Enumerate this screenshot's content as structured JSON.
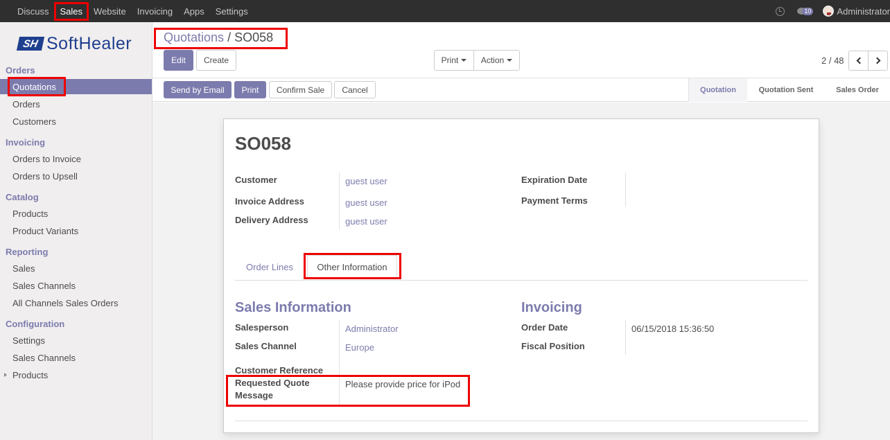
{
  "topbar": {
    "menu": [
      "Discuss",
      "Sales",
      "Website",
      "Invoicing",
      "Apps",
      "Settings"
    ],
    "messages_count": "10",
    "user_name": "Administrator"
  },
  "sidebar": {
    "logo_mark": "SH",
    "logo_text": "SoftHealer",
    "sections": {
      "orders": "Orders",
      "invoicing": "Invoicing",
      "catalog": "Catalog",
      "reporting": "Reporting",
      "configuration": "Configuration"
    },
    "items": {
      "quotations": "Quotations",
      "orders": "Orders",
      "customers": "Customers",
      "orders_to_invoice": "Orders to Invoice",
      "orders_to_upsell": "Orders to Upsell",
      "products": "Products",
      "product_variants": "Product Variants",
      "sales": "Sales",
      "sales_channels": "Sales Channels",
      "all_channels_sales_orders": "All Channels Sales Orders",
      "settings": "Settings",
      "config_sales_channels": "Sales Channels",
      "config_products": "Products"
    }
  },
  "control": {
    "breadcrumb_parent": "Quotations",
    "breadcrumb_separator": "/",
    "breadcrumb_current": "SO058",
    "edit": "Edit",
    "create": "Create",
    "print": "Print",
    "action": "Action",
    "pager": "2 / 48",
    "send_by_email": "Send by Email",
    "print_button": "Print",
    "confirm_sale": "Confirm Sale",
    "cancel": "Cancel",
    "statuses": [
      "Quotation",
      "Quotation Sent",
      "Sales Order"
    ]
  },
  "form": {
    "name": "SO058",
    "customer_label": "Customer",
    "customer": "guest user",
    "invoice_address_label": "Invoice Address",
    "invoice_address": "guest user",
    "delivery_address_label": "Delivery Address",
    "delivery_address": "guest user",
    "expiration_date_label": "Expiration Date",
    "payment_terms_label": "Payment Terms",
    "tabs": [
      "Order Lines",
      "Other Information"
    ],
    "sales_info_title": "Sales Information",
    "salesperson_label": "Salesperson",
    "salesperson": "Administrator",
    "sales_channel_label": "Sales Channel",
    "sales_channel": "Europe",
    "customer_reference_label": "Customer Reference",
    "requested_quote_label_1": "Requested Quote",
    "requested_quote_label_2": "Message",
    "requested_quote_message": "Please provide price for iPod",
    "invoicing_title": "Invoicing",
    "order_date_label": "Order Date",
    "order_date": "06/15/2018 15:36:50",
    "fiscal_position_label": "Fiscal Position"
  },
  "colors": {
    "accent": "#7c7bad",
    "highlight_box": "#ee0000",
    "navbar": "#2f2f2f"
  }
}
